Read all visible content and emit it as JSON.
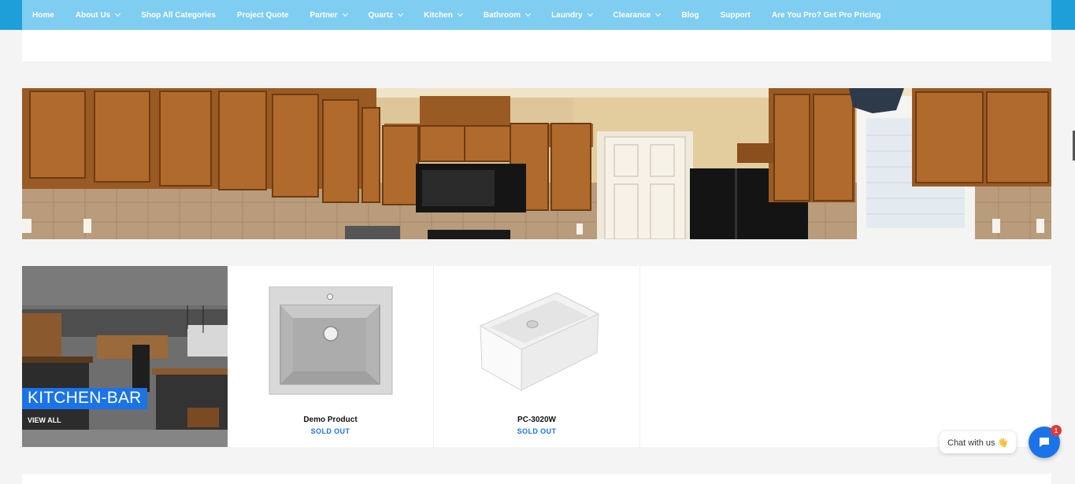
{
  "nav": {
    "items": [
      {
        "label": "Home",
        "dropdown": false
      },
      {
        "label": "About Us",
        "dropdown": true
      },
      {
        "label": "Shop All Categories",
        "dropdown": false
      },
      {
        "label": "Project Quote",
        "dropdown": false
      },
      {
        "label": "Partner",
        "dropdown": true
      },
      {
        "label": "Quartz",
        "dropdown": true
      },
      {
        "label": "Kitchen",
        "dropdown": true
      },
      {
        "label": "Bathroom",
        "dropdown": true
      },
      {
        "label": "Laundry",
        "dropdown": true
      },
      {
        "label": "Clearance",
        "dropdown": true
      },
      {
        "label": "Blog",
        "dropdown": false
      },
      {
        "label": "Support",
        "dropdown": false
      },
      {
        "label": "Are You Pro? Get Pro Pricing",
        "dropdown": false
      }
    ],
    "background": "#7fcdf0"
  },
  "collection": {
    "title": "KITCHEN-BAR",
    "link": "VIEW ALL"
  },
  "products": [
    {
      "title": "Demo Product",
      "status": "SOLD OUT"
    },
    {
      "title": "PC-3020W",
      "status": "SOLD OUT"
    }
  ],
  "chat": {
    "prompt": "Chat with us 👋",
    "badge": "1"
  },
  "colors": {
    "accent": "#1a73e8",
    "badge": "#e53935"
  }
}
